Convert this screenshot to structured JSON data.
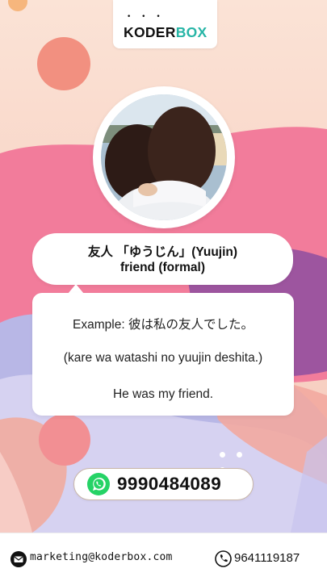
{
  "brand": {
    "dots": "• • •",
    "name_dark": "KODER",
    "name_accent": "BOX",
    "accent_color": "#27b5a6"
  },
  "vocab": {
    "word_line": "友人 「ゆうじん」(Yuujin)",
    "meaning": "friend (formal)"
  },
  "example": {
    "japanese": "Example: 彼は私の友人でした。",
    "romaji": "(kare wa watashi no yuujin deshita.)",
    "english": "He was my friend."
  },
  "contact": {
    "whatsapp": "9990484089",
    "email": "marketing@koderbox.com",
    "phone": "9641119187"
  },
  "icons": {
    "whatsapp": "whatsapp-icon",
    "mail": "mail-icon",
    "phone": "phone-icon"
  }
}
